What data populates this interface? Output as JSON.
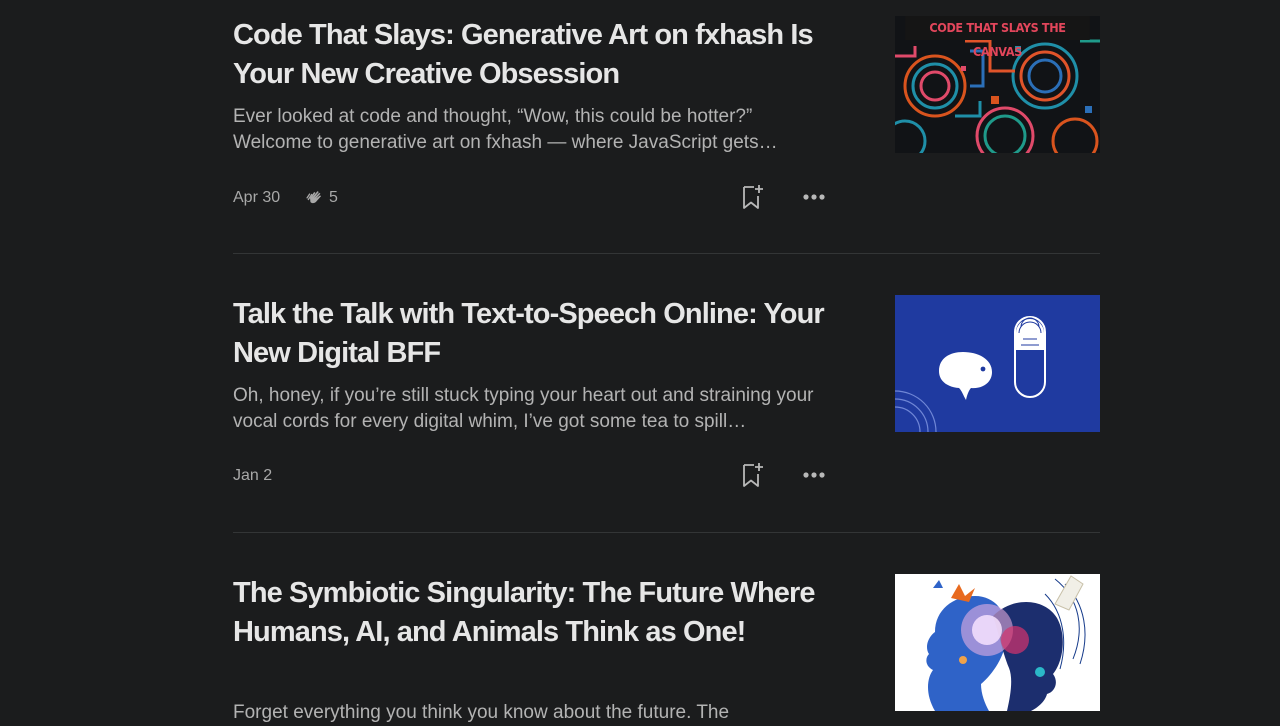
{
  "stories": [
    {
      "title": "Code That Slays: Generative Art on fxhash Is Your New Creative Obsession",
      "excerpt": "Ever looked at code and thought, “Wow, this could be hotter?” Welcome to generative art on fxhash — where JavaScript gets…",
      "date": "Apr 30",
      "claps": "5",
      "thumbnail_caption": "CODE THAT SLAYS THE CANVAS"
    },
    {
      "title": "Talk the Talk with Text-to-Speech Online: Your New Digital BFF",
      "excerpt": "Oh, honey, if you’re still stuck typing your heart out and straining your vocal cords for every digital whim, I’ve got some tea to spill…",
      "date": "Jan 2"
    },
    {
      "title": "The Symbiotic Singularity: The Future Where Humans, AI, and Animals Think as One!",
      "excerpt": "Forget everything you think you know about the future. The"
    }
  ],
  "icons": {
    "clap": "clap-icon",
    "save": "bookmark-add-icon",
    "more": "more-horizontal-icon"
  },
  "colors": {
    "background": "#1b1c1d",
    "title": "#e6e6e6",
    "excerpt": "#b3b3b3",
    "meta": "#a8a8a8",
    "divider": "#333536",
    "thumb2_blue": "#1f3aa0"
  }
}
